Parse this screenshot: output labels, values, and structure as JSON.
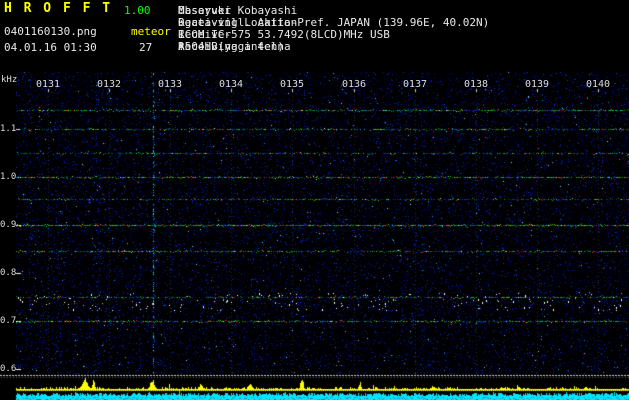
{
  "header": {
    "app_name": "H R O F F T",
    "version": "1.00",
    "filename": "0401160130.png",
    "mode": "meteor",
    "datetime": "04.01.16 01:30",
    "echo_count": "27",
    "separator": ":",
    "info": [
      {
        "label": "Observer",
        "value": "Masayuki Kobayashi"
      },
      {
        "label": "Receiving Location",
        "value": "Ogata-vill. Akita-Pref. JAPAN (139.96E, 40.02N)"
      },
      {
        "label": "Receiver",
        "value": "ICOM IC-575 53.7492(8LCD)MHz USB"
      },
      {
        "label": "Receiving antenna",
        "value": "A504HB(yagi 4el)"
      }
    ]
  },
  "chart_data": {
    "type": "heatmap",
    "subtype": "meteor-radio-spectrogram-10min-strip",
    "ylabel": "kHz",
    "y_ticks": [
      "1.1",
      "1.0",
      "0.9",
      "0.8",
      "0.7",
      "0.6"
    ],
    "y_tick_values": [
      1.1,
      1.0,
      0.9,
      0.8,
      0.7,
      0.6
    ],
    "freq_range_khz": [
      0.59,
      1.22
    ],
    "x_ticks": [
      "0131",
      "0132",
      "0133",
      "0134",
      "0135",
      "0136",
      "0137",
      "0138",
      "0139",
      "0140"
    ],
    "grid": "faint-dotted-minute-lines",
    "legend": "none",
    "traces": [
      {
        "khz": 1.14,
        "intensity": 0.5
      },
      {
        "khz": 1.1,
        "intensity": 0.4
      },
      {
        "khz": 1.05,
        "intensity": 0.28
      },
      {
        "khz": 1.0,
        "intensity": 0.55
      },
      {
        "khz": 0.955,
        "intensity": 0.33
      },
      {
        "khz": 0.9,
        "intensity": 0.7
      },
      {
        "khz": 0.845,
        "intensity": 0.45
      },
      {
        "khz": 0.75,
        "intensity": 0.38
      },
      {
        "khz": 0.7,
        "intensity": 0.5
      }
    ],
    "echo_band": {
      "khz": 0.745,
      "count": 170
    },
    "interference_events": [
      {
        "t": 2.72
      }
    ],
    "noise_columns": [
      {
        "t": 0.7,
        "density": 0.22
      },
      {
        "t": 1.15,
        "density": 0.3
      },
      {
        "t": 1.8,
        "density": 0.34
      },
      {
        "t": 2.5,
        "density": 0.2
      },
      {
        "t": 3.6,
        "density": 0.18
      },
      {
        "t": 7.1,
        "density": 0.14
      }
    ],
    "meter_spikes": [
      {
        "t": 1.6,
        "h": 13,
        "w": 4
      },
      {
        "t": 1.74,
        "h": 10,
        "w": 2
      },
      {
        "t": 2.7,
        "h": 12,
        "w": 3
      },
      {
        "t": 3.5,
        "h": 8,
        "w": 2
      },
      {
        "t": 4.3,
        "h": 7,
        "w": 3
      },
      {
        "t": 5.15,
        "h": 14,
        "w": 2
      },
      {
        "t": 6.1,
        "h": 8,
        "w": 2
      },
      {
        "t": 7.3,
        "h": 5,
        "w": 2
      },
      {
        "t": 8.7,
        "h": 5,
        "w": 2
      },
      {
        "t": 9.8,
        "h": 4,
        "w": 2
      }
    ]
  },
  "colors": {
    "background": "#000000",
    "title_yellow": "#ffff00",
    "version_green": "#00ff00",
    "header_text": "#e8e8e8",
    "axis_text": "#dddddd",
    "noise_blue": "#0020aa",
    "trace_green": "#00cc00",
    "trace_red": "#ff2200",
    "trace_yellow": "#ccff00",
    "trace_cyan": "#00ccff",
    "echo_white": "#ffffff",
    "meter_yellow": "#ffff00",
    "strip_cyan": "#00e6ff",
    "separator_gray": "#cccccc"
  }
}
